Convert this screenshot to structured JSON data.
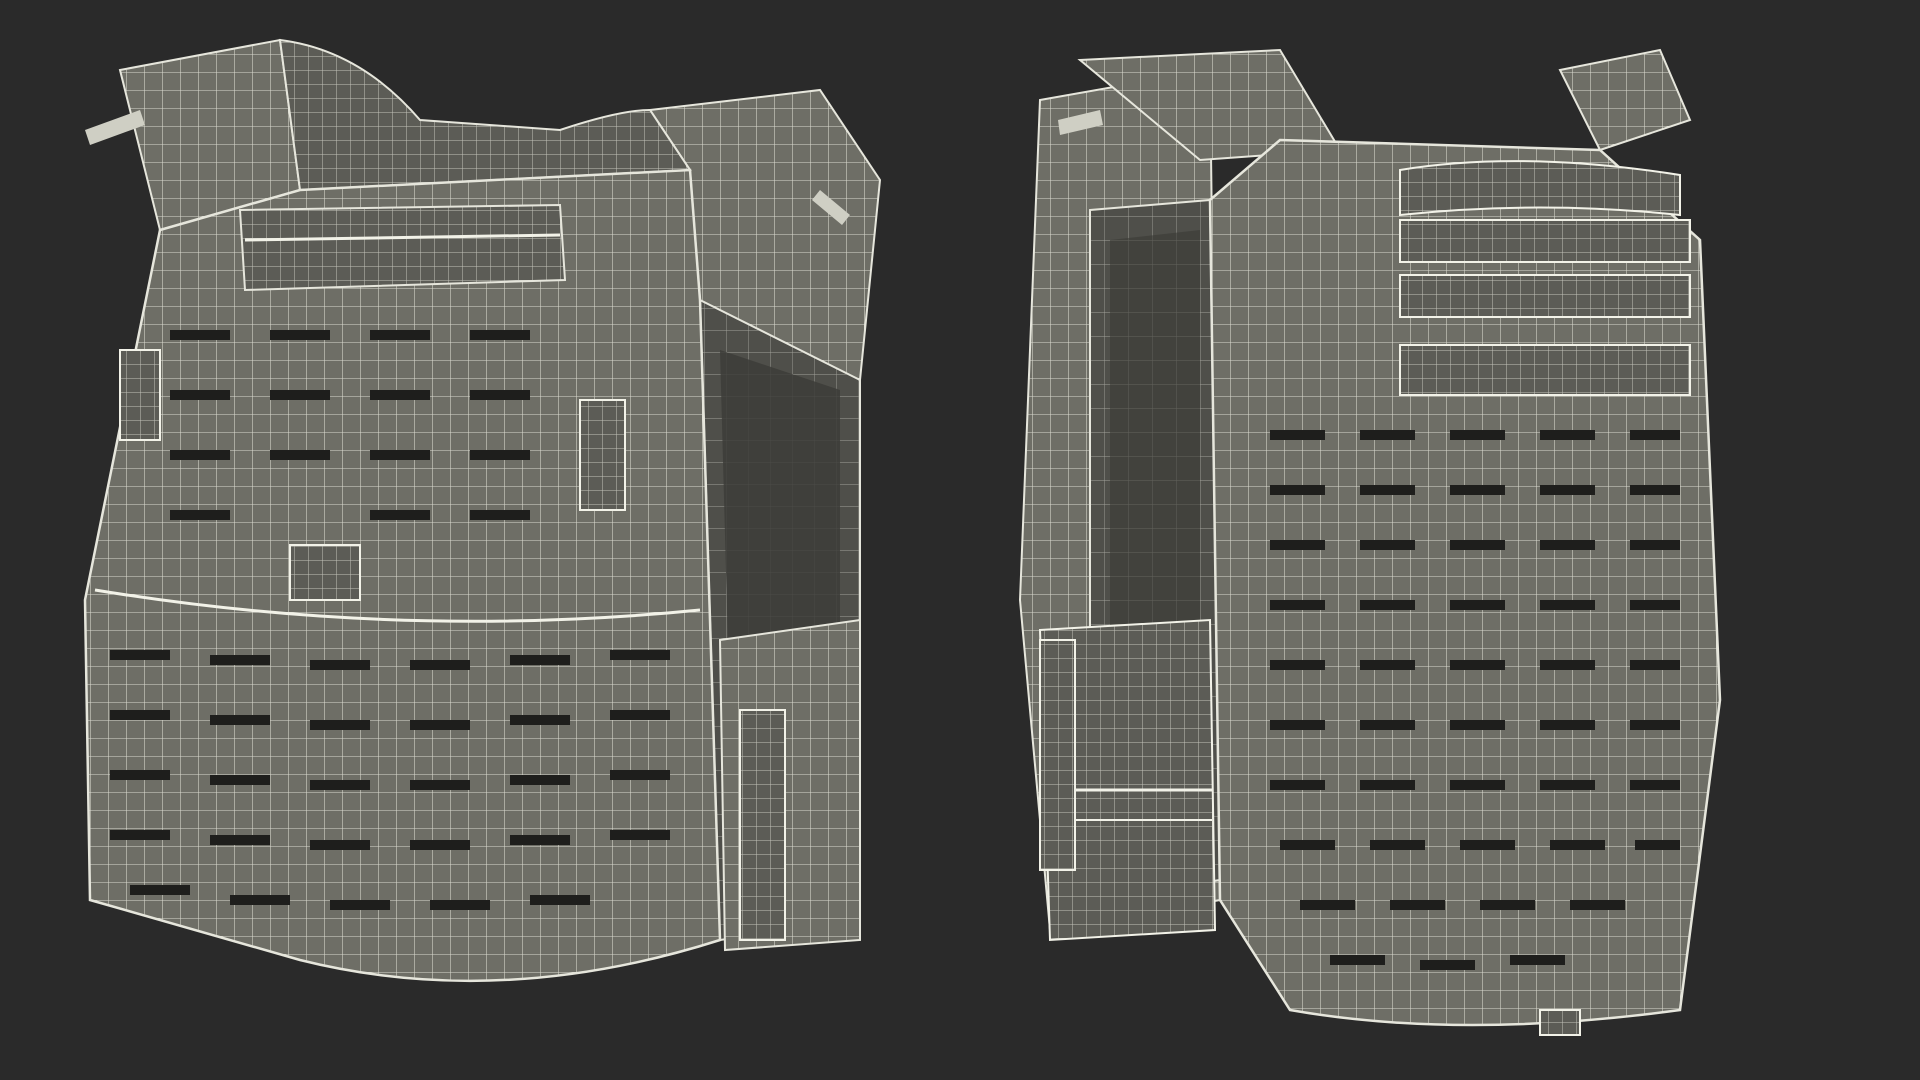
{
  "scene": {
    "background_color": "#2a2a2a",
    "mesh_fill_color": "#6e6e66",
    "mesh_shadow_color": "#55554f",
    "wire_color": "#e6e6dc",
    "slot_color": "#1e1e1c"
  },
  "views": [
    {
      "view": "front-three-quarter"
    },
    {
      "view": "back-three-quarter"
    }
  ]
}
